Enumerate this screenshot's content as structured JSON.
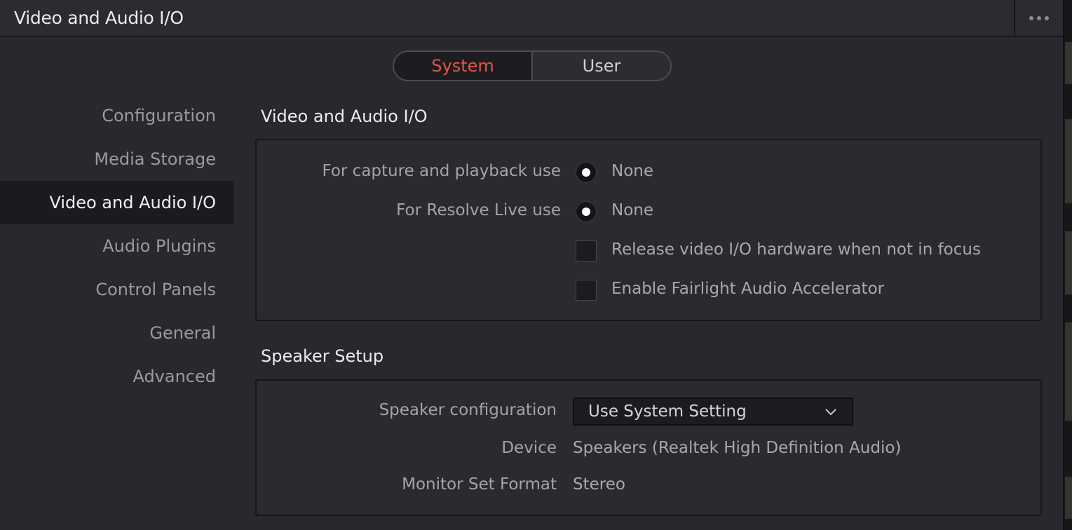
{
  "window": {
    "title": "Video and Audio I/O"
  },
  "tabs": {
    "system": "System",
    "user": "User",
    "active": "System"
  },
  "sidebar": {
    "items": [
      {
        "label": "Configuration"
      },
      {
        "label": "Media Storage"
      },
      {
        "label": "Video and Audio I/O"
      },
      {
        "label": "Audio Plugins"
      },
      {
        "label": "Control Panels"
      },
      {
        "label": "General"
      },
      {
        "label": "Advanced"
      }
    ],
    "active": "Video and Audio I/O"
  },
  "video_audio_io": {
    "title": "Video and Audio I/O",
    "capture_label": "For capture and playback use",
    "capture_value": "None",
    "resolve_live_label": "For Resolve Live use",
    "resolve_live_value": "None",
    "release_hw_label": "Release video I/O hardware when not in focus",
    "release_hw_checked": false,
    "fairlight_label": "Enable Fairlight Audio Accelerator",
    "fairlight_checked": false
  },
  "speaker_setup": {
    "title": "Speaker Setup",
    "config_label": "Speaker configuration",
    "config_value": "Use System Setting",
    "device_label": "Device",
    "device_value": "Speakers (Realtek High Definition Audio)",
    "monitor_label": "Monitor Set Format",
    "monitor_value": "Stereo"
  },
  "icons": {
    "more": "more-options-icon",
    "dropdown": "chevron-down-icon"
  },
  "colors": {
    "accent": "#e35746",
    "background": "#28282e",
    "panel": "#2a2a30"
  }
}
